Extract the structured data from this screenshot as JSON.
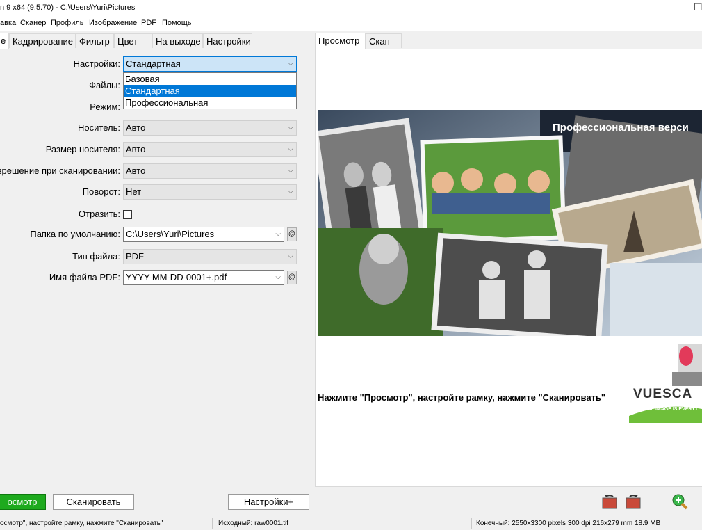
{
  "window": {
    "title": "n 9 x64 (9.5.70) - C:\\Users\\Yuri\\Pictures"
  },
  "menu": [
    "авка",
    "Сканер",
    "Профиль",
    "Изображение",
    "PDF",
    "Помощь"
  ],
  "left_tabs": [
    "е",
    "Кадрирование",
    "Фильтр",
    "Цвет",
    "На выходе",
    "Настройки"
  ],
  "right_tabs": [
    "Просмотр",
    "Скан"
  ],
  "form": {
    "settings_label": "Настройки:",
    "settings_value": "Стандартная",
    "settings_options": [
      "Базовая",
      "Стандартная",
      "Профессиональная"
    ],
    "files_label": "Файлы:",
    "mode_label": "Режим:",
    "media_label": "Носитель:",
    "media_value": "Авто",
    "media_size_label": "Размер носителя:",
    "media_size_value": "Авто",
    "scan_res_label": "зрешение при сканировании:",
    "scan_res_value": "Авто",
    "rotation_label": "Поворот:",
    "rotation_value": "Нет",
    "mirror_label": "Отразить:",
    "default_folder_label": "Папка по умолчанию:",
    "default_folder_value": "C:\\Users\\Yuri\\Pictures",
    "file_type_label": "Тип файла:",
    "file_type_value": "PDF",
    "pdf_name_label": "Имя файла PDF:",
    "pdf_name_value": "YYYY-MM-DD-0001+.pdf",
    "at_symbol": "@"
  },
  "preview": {
    "banner": "Профессиональная верси",
    "hint": "Нажмите \"Просмотр\", настройте рамку, нажмите \"Сканировать\"",
    "logo_text": "VUESCA",
    "logo_tag": "THE IMAGE IS EVERYT"
  },
  "buttons": {
    "preview": "осмотр",
    "scan": "Сканировать",
    "settings_plus": "Настройки+"
  },
  "status": {
    "left": "осмотр\", настройте рамку, нажмите \"Сканировать\"",
    "source": "Исходный: raw0001.tif",
    "output": "Конечный: 2550x3300 pixels 300 dpi 216x279 mm 18.9 MB"
  },
  "colors": {
    "accent": "#0078d7",
    "preview_button": "#1eaa1e"
  }
}
